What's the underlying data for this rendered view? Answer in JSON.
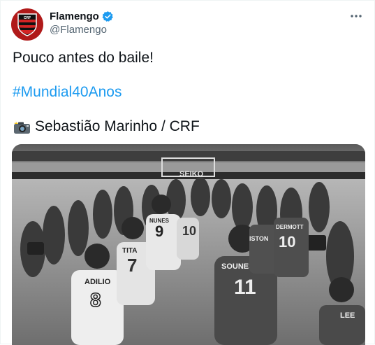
{
  "account": {
    "display_name": "Flamengo",
    "handle": "@Flamengo",
    "verified": true
  },
  "tweet": {
    "line1": "Pouco antes do baile!",
    "hashtag": "#Mundial40Anos",
    "credit_emoji": "camera-flash-icon",
    "credit": "Sebastião Marinho / CRF"
  },
  "photo": {
    "jersey_labels": [
      "ADILIO",
      "TITA",
      "NUNES",
      "SOUNESS",
      "LEE",
      "DERMOTT",
      "ISTON",
      "SEIKO"
    ],
    "jersey_numbers": [
      "8",
      "7",
      "9",
      "11",
      "10",
      "10"
    ]
  },
  "colors": {
    "brand_red": "#b01a1a",
    "link_blue": "#1d9bf0",
    "verified_blue": "#1d9bf0"
  }
}
